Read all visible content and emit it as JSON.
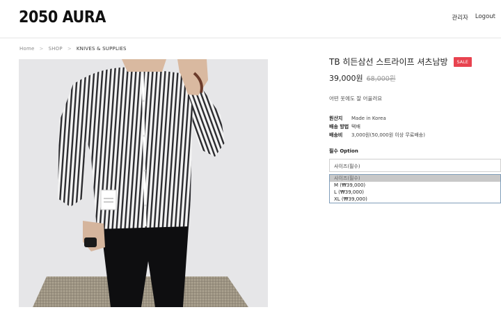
{
  "header": {
    "logo": "2050 AURA",
    "admin_link": "관리자",
    "logout_link": "Logout"
  },
  "breadcrumb": {
    "items": [
      "Home",
      "SHOP",
      "KNIVES & SUPPLIES"
    ]
  },
  "product": {
    "title": "TB 히든삼선 스트라이프 셔츠남방",
    "sale_badge": "SALE",
    "price": "39,000원",
    "old_price": "68,000원",
    "description": "어떤 옷에도 잘 어울려요",
    "specs": [
      {
        "key": "원산지",
        "value": "Made in Korea"
      },
      {
        "key": "배송 방법",
        "value": "택배"
      },
      {
        "key": "배송비",
        "value": "3,000원(50,000원 이상 무료배송)"
      }
    ],
    "option_label": "필수 Option",
    "select_value": "사이즈(필수)",
    "options": [
      "사이즈(필수)",
      "M (₩39,000)",
      "L (₩39,000)",
      "XL (₩39,000)"
    ]
  },
  "colors": {
    "sale": "#e8434f"
  }
}
